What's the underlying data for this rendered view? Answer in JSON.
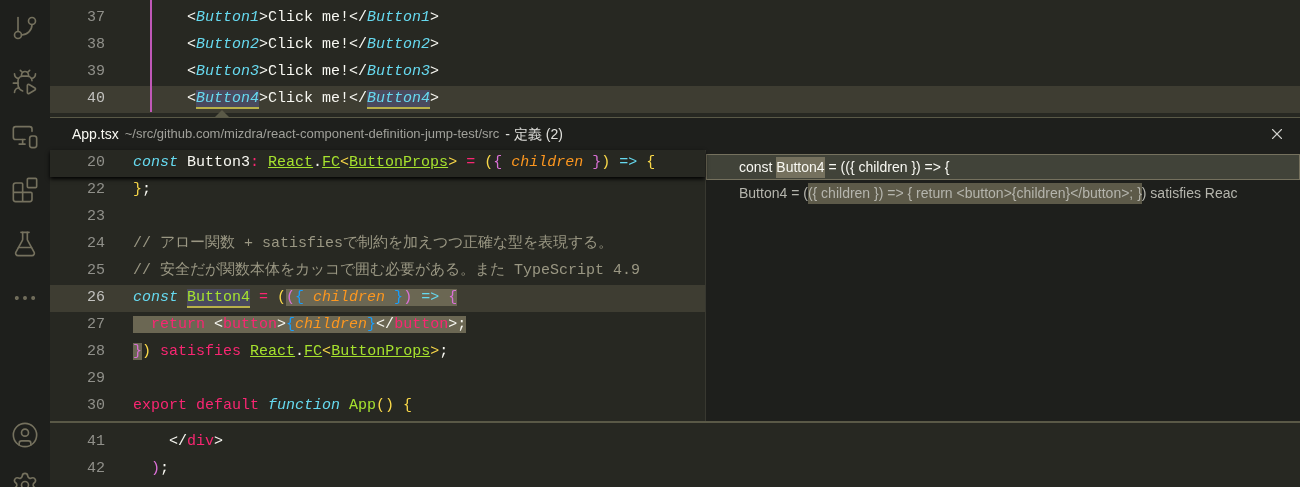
{
  "editor_top": {
    "lines": [
      {
        "number": "37",
        "current": false,
        "tokens": [
          {
            "t": "      <",
            "kind": "plain"
          },
          {
            "t": "Button1",
            "kind": "tag"
          },
          {
            "t": ">Click me!</",
            "kind": "plain"
          },
          {
            "t": "Button1",
            "kind": "tag"
          },
          {
            "t": ">",
            "kind": "plain"
          }
        ]
      },
      {
        "number": "38",
        "current": false,
        "tokens": [
          {
            "t": "      <",
            "kind": "plain"
          },
          {
            "t": "Button2",
            "kind": "tag"
          },
          {
            "t": ">Click me!</",
            "kind": "plain"
          },
          {
            "t": "Button2",
            "kind": "tag"
          },
          {
            "t": ">",
            "kind": "plain"
          }
        ]
      },
      {
        "number": "39",
        "current": false,
        "tokens": [
          {
            "t": "      <",
            "kind": "plain"
          },
          {
            "t": "Button3",
            "kind": "tag"
          },
          {
            "t": ">Click me!</",
            "kind": "plain"
          },
          {
            "t": "Button3",
            "kind": "tag"
          },
          {
            "t": ">",
            "kind": "plain"
          }
        ]
      },
      {
        "number": "40",
        "current": true,
        "tokens": [
          {
            "t": "      <",
            "kind": "plain"
          },
          {
            "t": "Button4",
            "kind": "tag",
            "word": true
          },
          {
            "t": ">Click me!</",
            "kind": "plain"
          },
          {
            "t": "Button4",
            "kind": "tag",
            "word": true
          },
          {
            "t": ">",
            "kind": "plain"
          }
        ]
      }
    ]
  },
  "peek": {
    "file": "App.tsx",
    "path": "~/src/github.com/mizdra/react-component-definition-jump-test/src",
    "title": "- 定義 (2)",
    "sticky_line": {
      "number": "20",
      "tokens": [
        {
          "t": "const ",
          "kind": "storage"
        },
        {
          "t": "Button3",
          "kind": "plain"
        },
        {
          "t": ": ",
          "kind": "op"
        },
        {
          "t": "React",
          "kind": "type"
        },
        {
          "t": ".",
          "kind": "plain"
        },
        {
          "t": "FC",
          "kind": "type"
        },
        {
          "t": "<",
          "kind": "b1"
        },
        {
          "t": "ButtonProps",
          "kind": "type"
        },
        {
          "t": ">",
          "kind": "b1"
        },
        {
          "t": " = ",
          "kind": "op"
        },
        {
          "t": "(",
          "kind": "b1"
        },
        {
          "t": "{ ",
          "kind": "b2"
        },
        {
          "t": "children ",
          "kind": "param"
        },
        {
          "t": "}",
          "kind": "b2"
        },
        {
          "t": ") ",
          "kind": "b1"
        },
        {
          "t": "=> ",
          "kind": "arrow"
        },
        {
          "t": "{",
          "kind": "b1"
        }
      ]
    },
    "lines": [
      {
        "number": "22",
        "current": false,
        "tokens": [
          {
            "t": "}",
            "kind": "b1"
          },
          {
            "t": ";",
            "kind": "plain"
          }
        ]
      },
      {
        "number": "23",
        "current": false
      },
      {
        "number": "24",
        "current": false,
        "tokens": [
          {
            "t": "// アロー関数 + satisfiesで制約を加えつつ正確な型を表現する。",
            "kind": "comment"
          }
        ]
      },
      {
        "number": "25",
        "current": false,
        "tokens": [
          {
            "t": "// 安全だが関数本体をカッコで囲む必要がある。また TypeScript 4.9",
            "kind": "comment"
          }
        ]
      },
      {
        "number": "26",
        "current": true,
        "tokens": [
          {
            "t": "const ",
            "kind": "storage"
          },
          {
            "t": "Button4",
            "kind": "func",
            "word": true
          },
          {
            "t": " = ",
            "kind": "op"
          },
          {
            "t": "(",
            "kind": "b1"
          },
          {
            "t": "(",
            "kind": "b2",
            "sel": true
          },
          {
            "t": "{ ",
            "kind": "b3",
            "sel": true
          },
          {
            "t": "children ",
            "kind": "param",
            "sel": true
          },
          {
            "t": "}",
            "kind": "b3",
            "sel": true
          },
          {
            "t": ") ",
            "kind": "b2",
            "sel": true
          },
          {
            "t": "=> ",
            "kind": "arrow",
            "sel": true
          },
          {
            "t": "{",
            "kind": "b2",
            "sel": true
          }
        ]
      },
      {
        "number": "27",
        "current": false,
        "tokens": [
          {
            "t": "  return",
            "kind": "keyword",
            "sel": true
          },
          {
            "t": " <",
            "kind": "plain",
            "sel": true
          },
          {
            "t": "button",
            "kind": "keyword",
            "sel": true
          },
          {
            "t": ">",
            "kind": "plain",
            "sel": true
          },
          {
            "t": "{",
            "kind": "b3",
            "sel": true
          },
          {
            "t": "children",
            "kind": "param",
            "sel": true
          },
          {
            "t": "}",
            "kind": "b3",
            "sel": true
          },
          {
            "t": "</",
            "kind": "plain",
            "sel": true
          },
          {
            "t": "button",
            "kind": "keyword",
            "sel": true
          },
          {
            "t": ">;",
            "kind": "plain",
            "sel": true
          }
        ]
      },
      {
        "number": "28",
        "current": false,
        "tokens": [
          {
            "t": "}",
            "kind": "b2",
            "sel": true
          },
          {
            "t": ")",
            "kind": "b1"
          },
          {
            "t": " satisfies ",
            "kind": "keyword"
          },
          {
            "t": "React",
            "kind": "type"
          },
          {
            "t": ".",
            "kind": "plain"
          },
          {
            "t": "FC",
            "kind": "type"
          },
          {
            "t": "<",
            "kind": "b1"
          },
          {
            "t": "ButtonProps",
            "kind": "type"
          },
          {
            "t": ">",
            "kind": "b1"
          },
          {
            "t": ";",
            "kind": "plain"
          }
        ]
      },
      {
        "number": "29",
        "current": false
      },
      {
        "number": "30",
        "current": false,
        "tokens": [
          {
            "t": "export default ",
            "kind": "keyword"
          },
          {
            "t": "function ",
            "kind": "storage"
          },
          {
            "t": "App",
            "kind": "func"
          },
          {
            "t": "() ",
            "kind": "b1"
          },
          {
            "t": "{",
            "kind": "b1"
          }
        ]
      }
    ],
    "references": [
      {
        "selected": true,
        "parts": [
          {
            "t": "const ",
            "match": false
          },
          {
            "t": "Button4",
            "match": true
          },
          {
            "t": " = (({ children }) => {",
            "match": false
          }
        ]
      },
      {
        "selected": false,
        "parts": [
          {
            "t": "Button4 = (",
            "match": false
          },
          {
            "t": "({ children }) => { return <button>{children}</button>; }",
            "match": true
          },
          {
            "t": ") satisfies Reac",
            "match": false
          }
        ]
      }
    ]
  },
  "editor_bottom": {
    "lines": [
      {
        "number": "41",
        "current": false,
        "tokens": [
          {
            "t": "    </",
            "kind": "plain"
          },
          {
            "t": "div",
            "kind": "keyword"
          },
          {
            "t": ">",
            "kind": "plain"
          }
        ]
      },
      {
        "number": "42",
        "current": false,
        "tokens": [
          {
            "t": "  )",
            "kind": "b2"
          },
          {
            "t": ";",
            "kind": "plain"
          }
        ]
      }
    ]
  }
}
